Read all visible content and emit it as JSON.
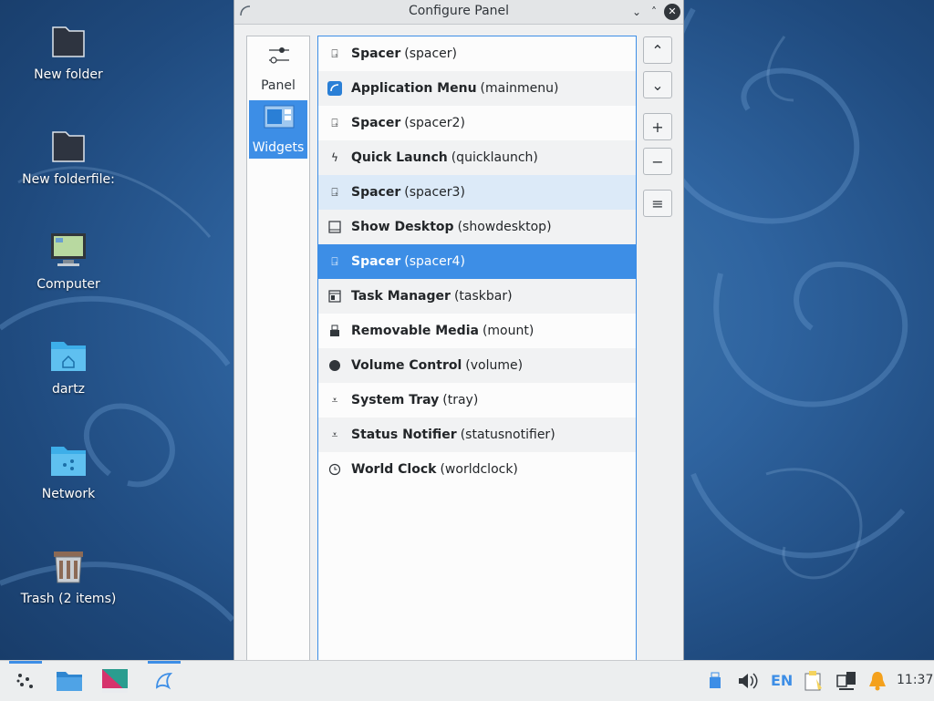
{
  "desktop": {
    "icons": [
      {
        "label": "New folder"
      },
      {
        "label": "New folderfile:"
      },
      {
        "label": "Computer"
      },
      {
        "label": "dartz"
      },
      {
        "label": "Network"
      },
      {
        "label": "Trash (2 items)"
      }
    ]
  },
  "window": {
    "title": "Configure Panel",
    "controls": {
      "minimize": "⌄",
      "maximize": "˄",
      "close": "✕"
    }
  },
  "categories": [
    {
      "label": "Panel",
      "icon": "sliders-icon",
      "active": false
    },
    {
      "label": "Widgets",
      "icon": "widgets-icon",
      "active": true
    }
  ],
  "widgets": [
    {
      "name": "Spacer",
      "id": "(spacer)",
      "icon": "spacer-icon"
    },
    {
      "name": "Application Menu",
      "id": "(mainmenu)",
      "icon": "app-menu-icon"
    },
    {
      "name": "Spacer",
      "id": "(spacer2)",
      "icon": "spacer-icon"
    },
    {
      "name": "Quick Launch",
      "id": "(quicklaunch)",
      "icon": "lightning-icon"
    },
    {
      "name": "Spacer",
      "id": "(spacer3)",
      "icon": "spacer-icon"
    },
    {
      "name": "Show Desktop",
      "id": "(showdesktop)",
      "icon": "desktop-icon"
    },
    {
      "name": "Spacer",
      "id": "(spacer4)",
      "icon": "spacer-icon"
    },
    {
      "name": "Task Manager",
      "id": "(taskbar)",
      "icon": "taskbar-icon"
    },
    {
      "name": "Removable Media",
      "id": "(mount)",
      "icon": "usb-icon"
    },
    {
      "name": "Volume Control",
      "id": "(volume)",
      "icon": "volume-dot-icon"
    },
    {
      "name": "System Tray",
      "id": "(tray)",
      "icon": "tray-icon"
    },
    {
      "name": "Status Notifier",
      "id": "(statusnotifier)",
      "icon": "tray-icon"
    },
    {
      "name": "World Clock",
      "id": "(worldclock)",
      "icon": "clock-icon"
    }
  ],
  "list_state": {
    "hover_row": 5,
    "selected_row": 7
  },
  "side_buttons": {
    "up": "⌃",
    "down": "⌄",
    "add": "+",
    "remove": "−",
    "menu": "≡"
  },
  "taskbar": {
    "language": "EN",
    "clock": "11:37"
  },
  "colors": {
    "accent": "#3d8ee6",
    "hover": "#dceaf8",
    "text": "#232629"
  }
}
